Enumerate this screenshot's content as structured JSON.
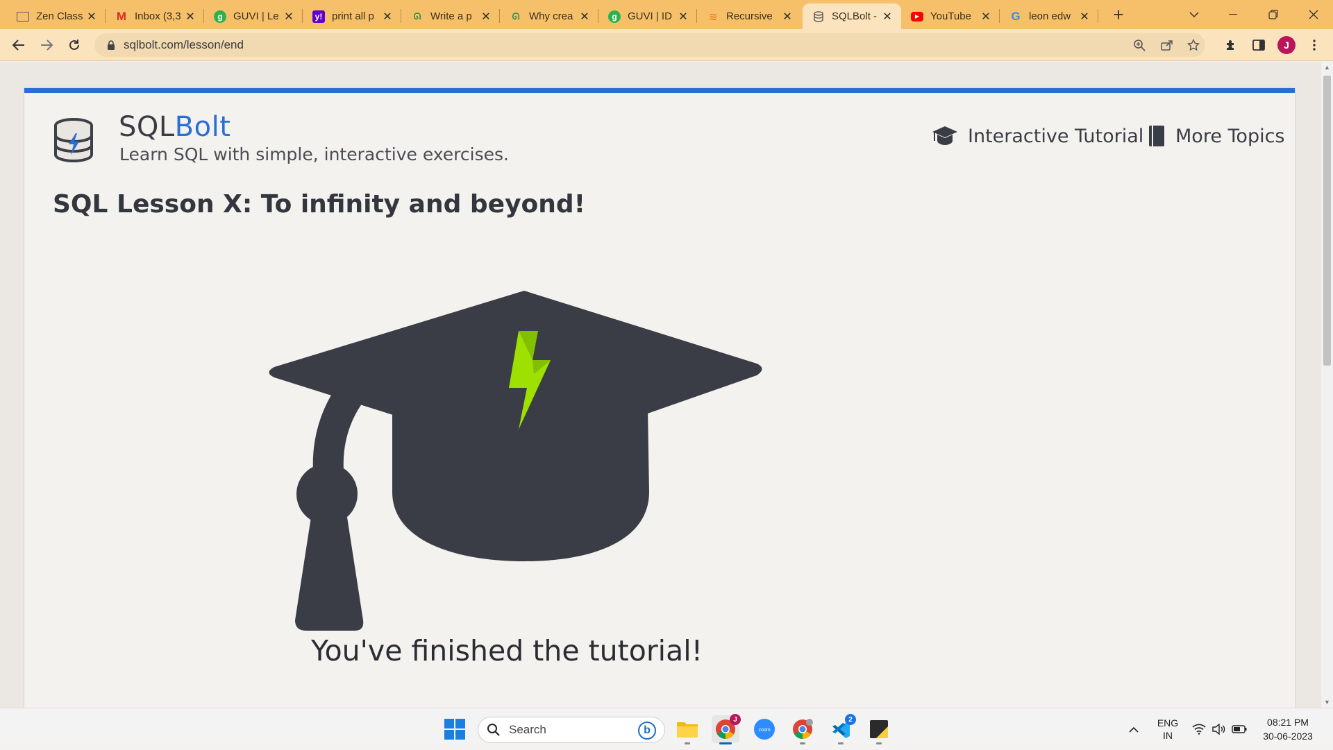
{
  "browser": {
    "tabs": [
      {
        "label": "Zen Class",
        "icon": "page-icon"
      },
      {
        "label": "Inbox (3,3",
        "icon": "gmail-icon"
      },
      {
        "label": "GUVI | Le",
        "icon": "guvi-icon"
      },
      {
        "label": "print all p",
        "icon": "yahoo-icon"
      },
      {
        "label": "Write a p",
        "icon": "geeksforgeeks-icon"
      },
      {
        "label": "Why crea",
        "icon": "geeksforgeeks-icon"
      },
      {
        "label": "GUVI | ID",
        "icon": "guvi-icon"
      },
      {
        "label": "Recursive",
        "icon": "stackoverflow-icon"
      },
      {
        "label": "SQLBolt -",
        "icon": "sqlbolt-icon",
        "active": true
      },
      {
        "label": "YouTube",
        "icon": "youtube-icon"
      },
      {
        "label": "leon edw",
        "icon": "google-icon"
      }
    ],
    "new_tab": "+",
    "url": "sqlbolt.com/lesson/end",
    "profile_initial": "J"
  },
  "page": {
    "brand_prefix": "SQL",
    "brand_accent": "Bolt",
    "tagline": "Learn SQL with simple, interactive exercises.",
    "nav": {
      "interactive_tutorial": "Interactive Tutorial",
      "more_topics": "More Topics"
    },
    "lesson_title": "SQL Lesson X: To infinity and beyond!",
    "finished_message": "You've finished the tutorial!"
  },
  "taskbar": {
    "search_label": "Search",
    "lang_line1": "ENG",
    "lang_line2": "IN",
    "time": "08:21 PM",
    "date": "30-06-2023",
    "chrome_badge": "J",
    "vscode_badge": "2"
  },
  "colors": {
    "accent_blue": "#2b6fd6",
    "tabbar": "#f6c06a",
    "toolbar": "#fbe3bd",
    "cap_dark": "#3a3d45",
    "bolt_green": "#9ee000"
  }
}
